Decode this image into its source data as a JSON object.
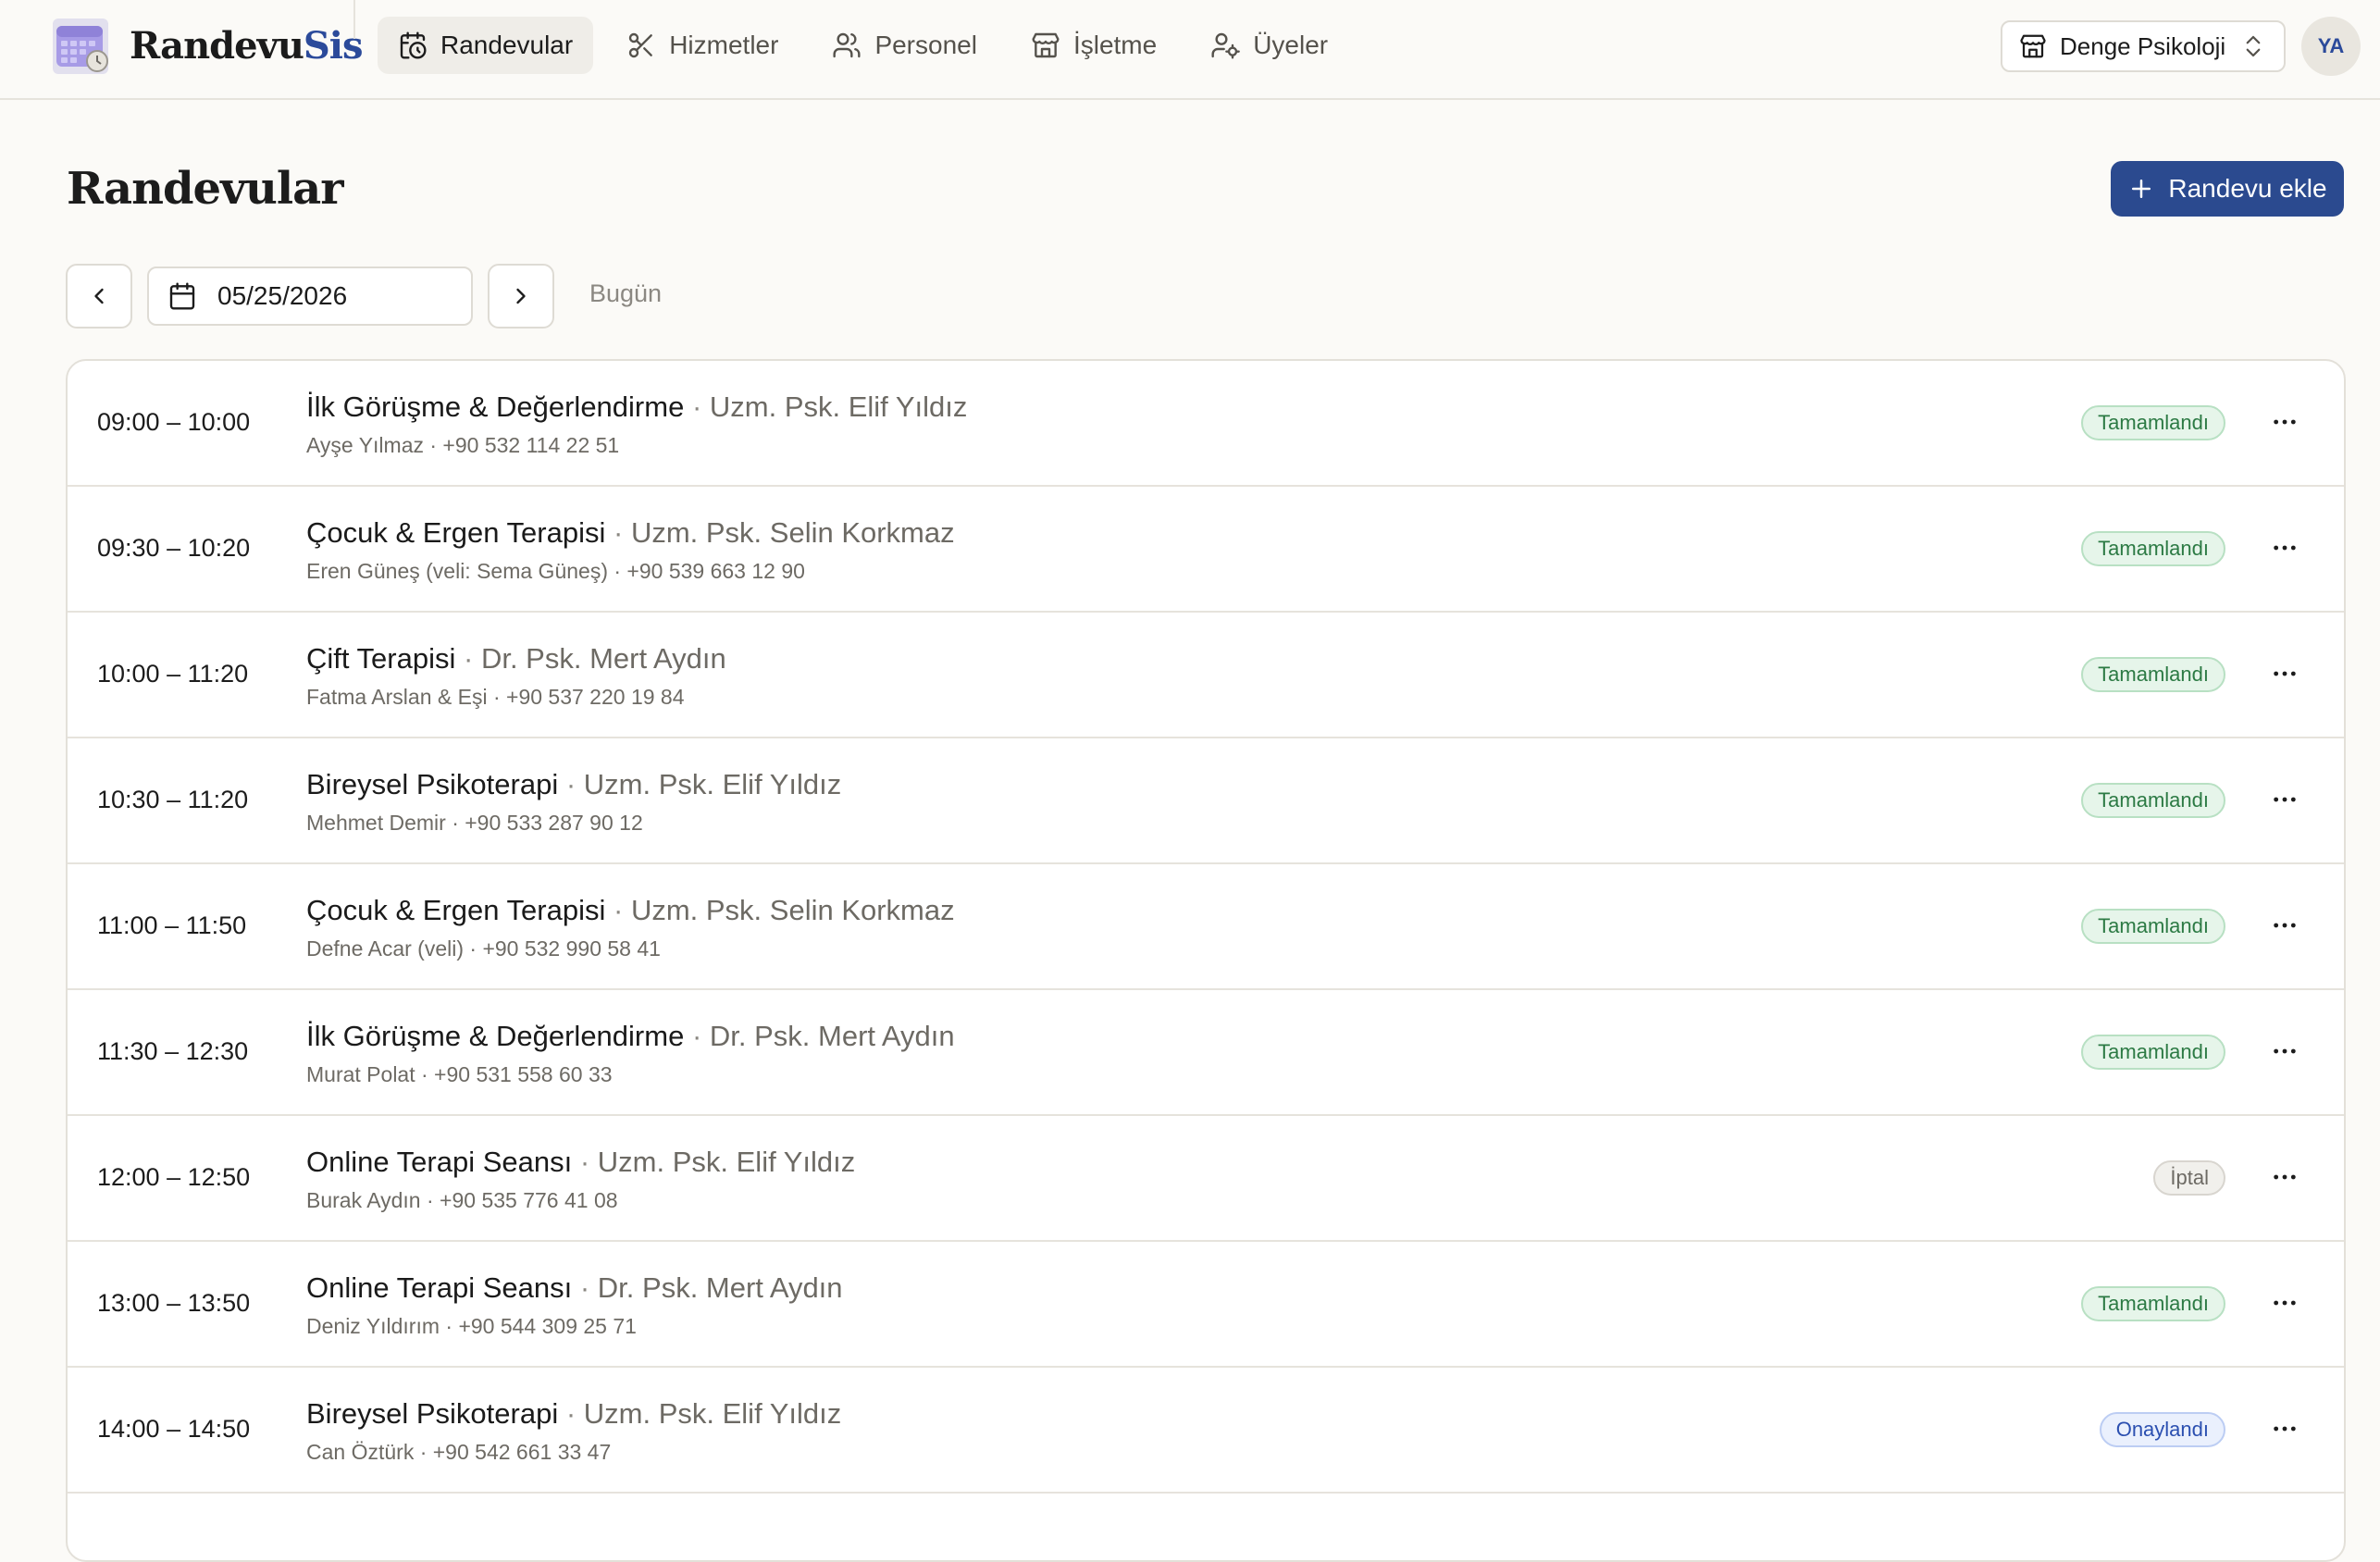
{
  "brand": {
    "part1": "Randevu",
    "part2": "Sis"
  },
  "nav": [
    {
      "label": "Randevular",
      "icon": "calendar-clock-icon",
      "active": true
    },
    {
      "label": "Hizmetler",
      "icon": "scissors-icon"
    },
    {
      "label": "Personel",
      "icon": "users-icon"
    },
    {
      "label": "İşletme",
      "icon": "store-icon"
    },
    {
      "label": "Üyeler",
      "icon": "user-cog-icon"
    }
  ],
  "business": {
    "selected": "Denge Psikoloji"
  },
  "user": {
    "initials": "YA"
  },
  "page": {
    "title": "Randevular",
    "add_button": "Randevu ekle"
  },
  "date_bar": {
    "date": "05/25/2026",
    "today": "Bugün"
  },
  "colors": {
    "accent": "#2b4a8f",
    "done": "#2c7a44",
    "ok": "#2b4fb0",
    "cancel": "#6d6a64"
  },
  "appointments": [
    {
      "time": "09:00 – 10:00",
      "service": "İlk Görüşme & Değerlendirme",
      "staff": "Uzm. Psk. Elif Yıldız",
      "client": "Ayşe Yılmaz · +90 532 114 22 51",
      "status": "Tamamlandı",
      "status_type": "done"
    },
    {
      "time": "09:30 – 10:20",
      "service": "Çocuk & Ergen Terapisi",
      "staff": "Uzm. Psk. Selin Korkmaz",
      "client": "Eren Güneş (veli: Sema Güneş) · +90 539 663 12 90",
      "status": "Tamamlandı",
      "status_type": "done"
    },
    {
      "time": "10:00 – 11:20",
      "service": "Çift Terapisi",
      "staff": "Dr. Psk. Mert Aydın",
      "client": "Fatma Arslan & Eşi · +90 537 220 19 84",
      "status": "Tamamlandı",
      "status_type": "done"
    },
    {
      "time": "10:30 – 11:20",
      "service": "Bireysel Psikoterapi",
      "staff": "Uzm. Psk. Elif Yıldız",
      "client": "Mehmet Demir · +90 533 287 90 12",
      "status": "Tamamlandı",
      "status_type": "done"
    },
    {
      "time": "11:00 – 11:50",
      "service": "Çocuk & Ergen Terapisi",
      "staff": "Uzm. Psk. Selin Korkmaz",
      "client": "Defne Acar (veli) · +90 532 990 58 41",
      "status": "Tamamlandı",
      "status_type": "done"
    },
    {
      "time": "11:30 – 12:30",
      "service": "İlk Görüşme & Değerlendirme",
      "staff": "Dr. Psk. Mert Aydın",
      "client": "Murat Polat · +90 531 558 60 33",
      "status": "Tamamlandı",
      "status_type": "done"
    },
    {
      "time": "12:00 – 12:50",
      "service": "Online Terapi Seansı",
      "staff": "Uzm. Psk. Elif Yıldız",
      "client": "Burak Aydın · +90 535 776 41 08",
      "status": "İptal",
      "status_type": "cancel"
    },
    {
      "time": "13:00 – 13:50",
      "service": "Online Terapi Seansı",
      "staff": "Dr. Psk. Mert Aydın",
      "client": "Deniz Yıldırım · +90 544 309 25 71",
      "status": "Tamamlandı",
      "status_type": "done"
    },
    {
      "time": "14:00 – 14:50",
      "service": "Bireysel Psikoterapi",
      "staff": "Uzm. Psk. Elif Yıldız",
      "client": "Can Öztürk · +90 542 661 33 47",
      "status": "Onaylandı",
      "status_type": "ok"
    }
  ]
}
